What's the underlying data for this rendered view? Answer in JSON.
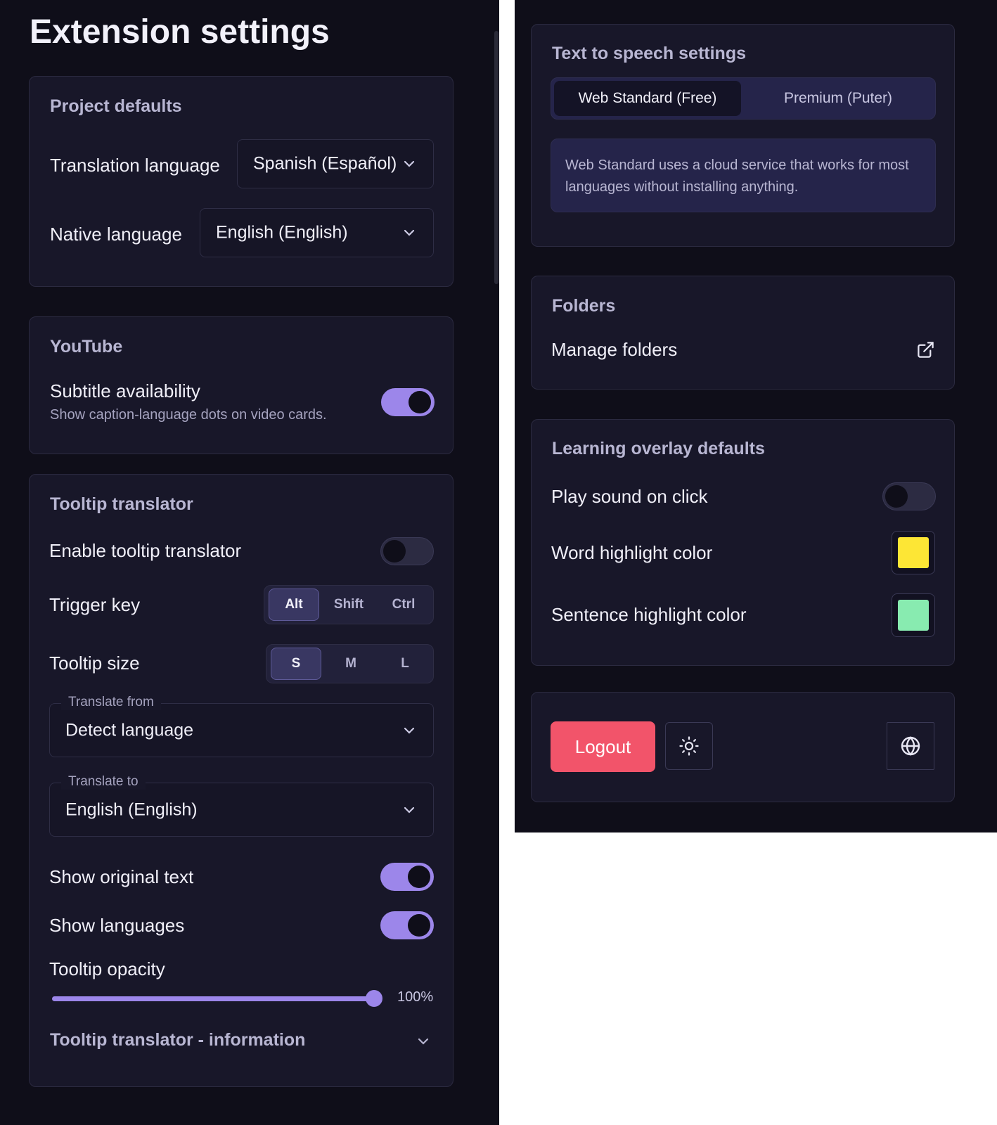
{
  "page": {
    "title": "Extension settings"
  },
  "project_defaults": {
    "title": "Project defaults",
    "translation_language": {
      "label": "Translation language",
      "value": "Spanish (Español)"
    },
    "native_language": {
      "label": "Native language",
      "value": "English (English)"
    }
  },
  "youtube": {
    "title": "YouTube",
    "subtitle_availability": {
      "label": "Subtitle availability",
      "description": "Show caption-language dots on video cards.",
      "enabled": true
    }
  },
  "tooltip": {
    "title": "Tooltip translator",
    "enable": {
      "label": "Enable tooltip translator",
      "enabled": false
    },
    "trigger_key": {
      "label": "Trigger key",
      "options": [
        "Alt",
        "Shift",
        "Ctrl"
      ],
      "selected": "Alt"
    },
    "size": {
      "label": "Tooltip size",
      "options": [
        "S",
        "M",
        "L"
      ],
      "selected": "S"
    },
    "translate_from": {
      "label": "Translate from",
      "value": "Detect language"
    },
    "translate_to": {
      "label": "Translate to",
      "value": "English (English)"
    },
    "show_original": {
      "label": "Show original text",
      "enabled": true
    },
    "show_languages": {
      "label": "Show languages",
      "enabled": true
    },
    "opacity": {
      "label": "Tooltip opacity",
      "value_text": "100%",
      "value": 100
    },
    "info": {
      "label": "Tooltip translator - information"
    }
  },
  "tts": {
    "title": "Text to speech settings",
    "tabs": [
      "Web Standard (Free)",
      "Premium (Puter)"
    ],
    "selected": "Web Standard (Free)",
    "info": "Web Standard uses a cloud service that works for most languages without installing anything."
  },
  "folders": {
    "title": "Folders",
    "manage_label": "Manage folders"
  },
  "overlay": {
    "title": "Learning overlay defaults",
    "play_sound": {
      "label": "Play sound on click",
      "enabled": false
    },
    "word_color": {
      "label": "Word highlight color",
      "color": "#fde635"
    },
    "sentence_color": {
      "label": "Sentence highlight color",
      "color": "#88ebb0"
    }
  },
  "footer": {
    "logout_label": "Logout"
  },
  "colors": {
    "accent": "#9c86ea",
    "danger": "#f2546a",
    "background": "#0f0e19",
    "card": "#181729"
  }
}
